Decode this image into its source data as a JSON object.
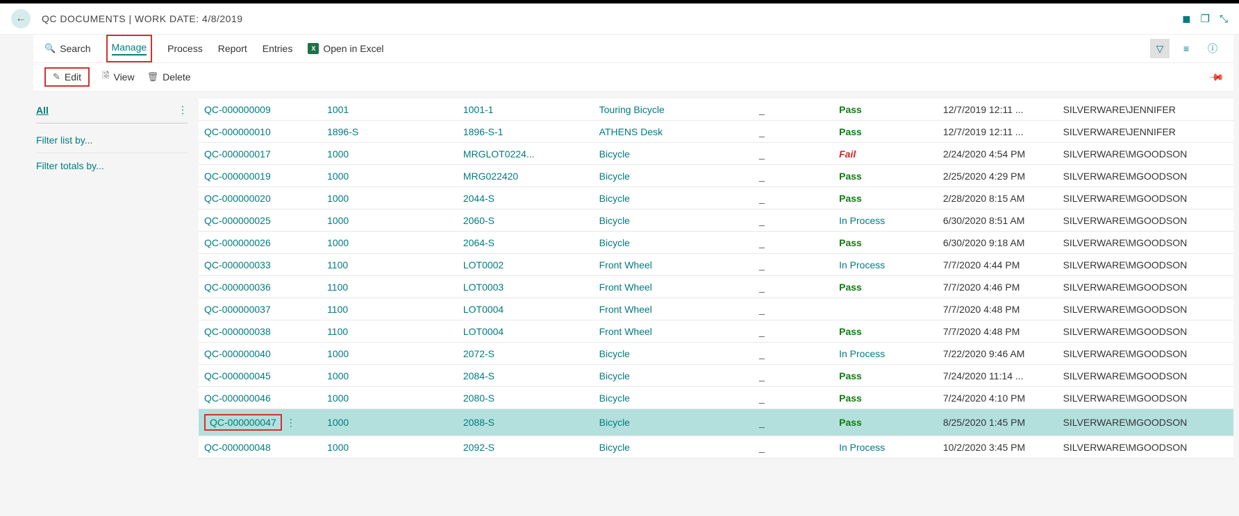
{
  "page_title": "QC DOCUMENTS | WORK DATE: 4/8/2019",
  "ribbon": {
    "search": "Search",
    "manage": "Manage",
    "process": "Process",
    "report": "Report",
    "entries": "Entries",
    "open_excel": "Open in Excel"
  },
  "subribbon": {
    "edit": "Edit",
    "view": "View",
    "delete": "Delete"
  },
  "filter": {
    "all": "All",
    "list_by": "Filter list by...",
    "totals_by": "Filter totals by..."
  },
  "rows": [
    {
      "doc": "QC-000000009",
      "item": "1001",
      "lot": "1001-1",
      "desc": "Touring Bicycle",
      "dash": "_",
      "status": "Pass",
      "status_class": "status-pass",
      "date": "12/7/2019 12:11 ...",
      "user": "SILVERWARE\\JENNIFER",
      "selected": false,
      "boxed": false
    },
    {
      "doc": "QC-000000010",
      "item": "1896-S",
      "lot": "1896-S-1",
      "desc": "ATHENS Desk",
      "dash": "_",
      "status": "Pass",
      "status_class": "status-pass",
      "date": "12/7/2019 12:11 ...",
      "user": "SILVERWARE\\JENNIFER",
      "selected": false,
      "boxed": false
    },
    {
      "doc": "QC-000000017",
      "item": "1000",
      "lot": "MRGLOT0224...",
      "desc": "Bicycle",
      "dash": "_",
      "status": "Fail",
      "status_class": "status-fail",
      "date": "2/24/2020 4:54 PM",
      "user": "SILVERWARE\\MGOODSON",
      "selected": false,
      "boxed": false
    },
    {
      "doc": "QC-000000019",
      "item": "1000",
      "lot": "MRG022420",
      "desc": "Bicycle",
      "dash": "_",
      "status": "Pass",
      "status_class": "status-pass",
      "date": "2/25/2020 4:29 PM",
      "user": "SILVERWARE\\MGOODSON",
      "selected": false,
      "boxed": false
    },
    {
      "doc": "QC-000000020",
      "item": "1000",
      "lot": "2044-S",
      "desc": "Bicycle",
      "dash": "_",
      "status": "Pass",
      "status_class": "status-pass",
      "date": "2/28/2020 8:15 AM",
      "user": "SILVERWARE\\MGOODSON",
      "selected": false,
      "boxed": false
    },
    {
      "doc": "QC-000000025",
      "item": "1000",
      "lot": "2060-S",
      "desc": "Bicycle",
      "dash": "_",
      "status": "In Process",
      "status_class": "status-inproc",
      "date": "6/30/2020 8:51 AM",
      "user": "SILVERWARE\\MGOODSON",
      "selected": false,
      "boxed": false
    },
    {
      "doc": "QC-000000026",
      "item": "1000",
      "lot": "2064-S",
      "desc": "Bicycle",
      "dash": "_",
      "status": "Pass",
      "status_class": "status-pass",
      "date": "6/30/2020 9:18 AM",
      "user": "SILVERWARE\\MGOODSON",
      "selected": false,
      "boxed": false
    },
    {
      "doc": "QC-000000033",
      "item": "1100",
      "lot": "LOT0002",
      "desc": "Front Wheel",
      "dash": "_",
      "status": "In Process",
      "status_class": "status-inproc",
      "date": "7/7/2020 4:44 PM",
      "user": "SILVERWARE\\MGOODSON",
      "selected": false,
      "boxed": false
    },
    {
      "doc": "QC-000000036",
      "item": "1100",
      "lot": "LOT0003",
      "desc": "Front Wheel",
      "dash": "_",
      "status": "Pass",
      "status_class": "status-pass",
      "date": "7/7/2020 4:46 PM",
      "user": "SILVERWARE\\MGOODSON",
      "selected": false,
      "boxed": false
    },
    {
      "doc": "QC-000000037",
      "item": "1100",
      "lot": "LOT0004",
      "desc": "Front Wheel",
      "dash": "_",
      "status": "",
      "status_class": "",
      "date": "7/7/2020 4:48 PM",
      "user": "SILVERWARE\\MGOODSON",
      "selected": false,
      "boxed": false
    },
    {
      "doc": "QC-000000038",
      "item": "1100",
      "lot": "LOT0004",
      "desc": "Front Wheel",
      "dash": "_",
      "status": "Pass",
      "status_class": "status-pass",
      "date": "7/7/2020 4:48 PM",
      "user": "SILVERWARE\\MGOODSON",
      "selected": false,
      "boxed": false
    },
    {
      "doc": "QC-000000040",
      "item": "1000",
      "lot": "2072-S",
      "desc": "Bicycle",
      "dash": "_",
      "status": "In Process",
      "status_class": "status-inproc",
      "date": "7/22/2020 9:46 AM",
      "user": "SILVERWARE\\MGOODSON",
      "selected": false,
      "boxed": false
    },
    {
      "doc": "QC-000000045",
      "item": "1000",
      "lot": "2084-S",
      "desc": "Bicycle",
      "dash": "_",
      "status": "Pass",
      "status_class": "status-pass",
      "date": "7/24/2020 11:14 ...",
      "user": "SILVERWARE\\MGOODSON",
      "selected": false,
      "boxed": false
    },
    {
      "doc": "QC-000000046",
      "item": "1000",
      "lot": "2080-S",
      "desc": "Bicycle",
      "dash": "_",
      "status": "Pass",
      "status_class": "status-pass",
      "date": "7/24/2020 4:10 PM",
      "user": "SILVERWARE\\MGOODSON",
      "selected": false,
      "boxed": false
    },
    {
      "doc": "QC-000000047",
      "item": "1000",
      "lot": "2088-S",
      "desc": "Bicycle",
      "dash": "_",
      "status": "Pass",
      "status_class": "status-pass",
      "date": "8/25/2020 1:45 PM",
      "user": "SILVERWARE\\MGOODSON",
      "selected": true,
      "boxed": true
    },
    {
      "doc": "QC-000000048",
      "item": "1000",
      "lot": "2092-S",
      "desc": "Bicycle",
      "dash": "_",
      "status": "In Process",
      "status_class": "status-inproc",
      "date": "10/2/2020 3:45 PM",
      "user": "SILVERWARE\\MGOODSON",
      "selected": false,
      "boxed": false
    }
  ]
}
